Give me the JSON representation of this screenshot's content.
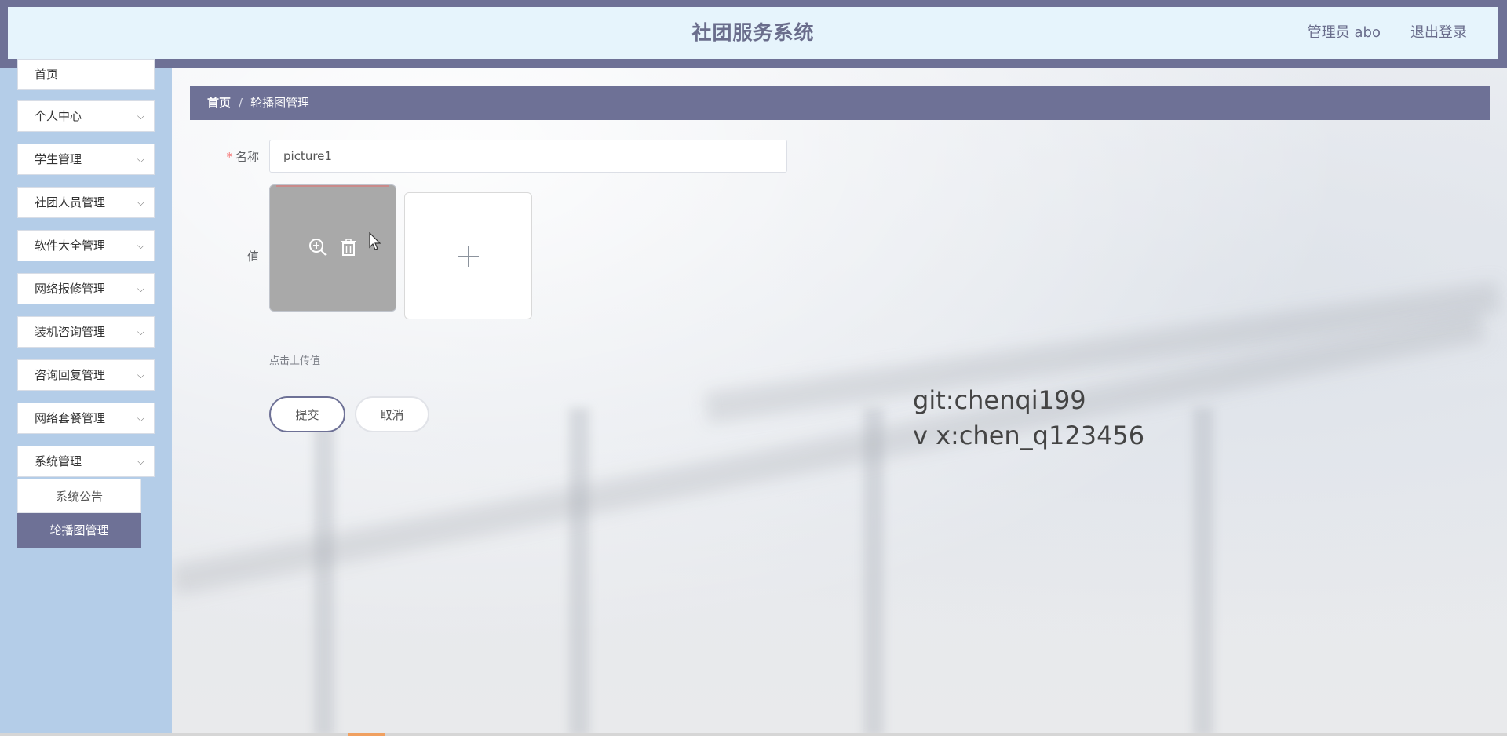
{
  "header": {
    "title": "社团服务系统",
    "admin": "管理员 abo",
    "logout": "退出登录"
  },
  "sidebar": {
    "items": [
      {
        "label": "首页",
        "chevron": false
      },
      {
        "label": "个人中心",
        "chevron": true
      },
      {
        "label": "学生管理",
        "chevron": true
      },
      {
        "label": "社团人员管理",
        "chevron": true
      },
      {
        "label": "软件大全管理",
        "chevron": true
      },
      {
        "label": "网络报修管理",
        "chevron": true
      },
      {
        "label": "装机咨询管理",
        "chevron": true
      },
      {
        "label": "咨询回复管理",
        "chevron": true
      },
      {
        "label": "网络套餐管理",
        "chevron": true
      },
      {
        "label": "系统管理",
        "chevron": true
      }
    ],
    "submenu": [
      {
        "label": "系统公告",
        "active": false
      },
      {
        "label": "轮播图管理",
        "active": true
      }
    ]
  },
  "breadcrumb": {
    "home": "首页",
    "separator": "/",
    "current": "轮播图管理"
  },
  "form": {
    "name_label": "名称",
    "required_mark": "*",
    "name_value": "picture1",
    "value_label": "值",
    "upload_hint": "点击上传值",
    "submit_label": "提交",
    "cancel_label": "取消"
  },
  "watermark": {
    "line1": "git:chenqi199",
    "line2": "v x:chen_q123456"
  },
  "icons": {
    "zoom": "zoom-in-icon",
    "delete": "trash-icon",
    "upload": "plus-icon",
    "chevron": "chevron-down-icon"
  },
  "colors": {
    "accent": "#6e7196",
    "header_bg": "#e6f4fc",
    "sidebar_bg": "#b4cde8",
    "required": "#f56c6c"
  }
}
